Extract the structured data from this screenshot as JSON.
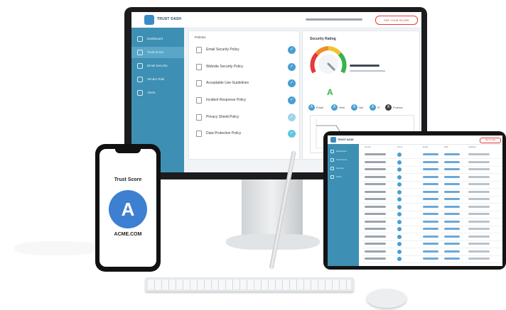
{
  "desktop": {
    "app_name": "TRUST DASH",
    "top_button": "SEE YOUR SCORE",
    "sidebar": [
      {
        "label": "Dashboard",
        "icon": "dashboard-icon",
        "active": false
      },
      {
        "label": "Trust Score",
        "icon": "shield-icon",
        "active": true
      },
      {
        "label": "Email Security",
        "icon": "mail-icon",
        "active": false
      },
      {
        "label": "Vendor Risk",
        "icon": "building-icon",
        "active": false
      },
      {
        "label": "Alerts",
        "icon": "bell-icon",
        "active": false
      }
    ],
    "policies_title": "Policies",
    "policies": [
      {
        "label": "Email Security Policy",
        "check": "✓"
      },
      {
        "label": "Website Security Policy",
        "check": "✓"
      },
      {
        "label": "Acceptable Use Guidelines",
        "check": "✓"
      },
      {
        "label": "Incident Response Policy",
        "check": "✓"
      },
      {
        "label": "Privacy Shield Policy",
        "check": "✓"
      },
      {
        "label": "Data Protection Policy",
        "check": "✓"
      }
    ],
    "score": {
      "title": "Security Rating",
      "grade": "A",
      "gauge_level": 0.9,
      "categories": [
        {
          "label": "Email",
          "letter": "A",
          "color": "#4a9ed0"
        },
        {
          "label": "Web",
          "letter": "A",
          "color": "#4a9ed0"
        },
        {
          "label": "Net",
          "letter": "A",
          "color": "#4a9ed0"
        },
        {
          "label": "IP",
          "letter": "A",
          "color": "#4a9ed0"
        },
        {
          "label": "Policies",
          "letter": "A",
          "color": "#3a3f44"
        }
      ]
    }
  },
  "phone": {
    "title": "Trust Score",
    "grade": "A",
    "domain": "ACME.COM"
  },
  "tablet": {
    "app_name": "TRUST DASH",
    "top_button": "SEE SCORE",
    "sidebar": [
      {
        "label": "Dashboard",
        "icon": "dashboard-icon"
      },
      {
        "label": "Trust Score",
        "icon": "shield-icon"
      },
      {
        "label": "Vendors",
        "icon": "building-icon"
      },
      {
        "label": "Alerts",
        "icon": "bell-icon"
      }
    ],
    "columns": [
      "Vendor",
      "Score",
      "Email",
      "Web",
      "Updated"
    ]
  },
  "colors": {
    "brand": "#3d8fb3",
    "accent": "#4a9ed0",
    "grade_green": "#37b24d",
    "alert_red": "#e5393b"
  }
}
